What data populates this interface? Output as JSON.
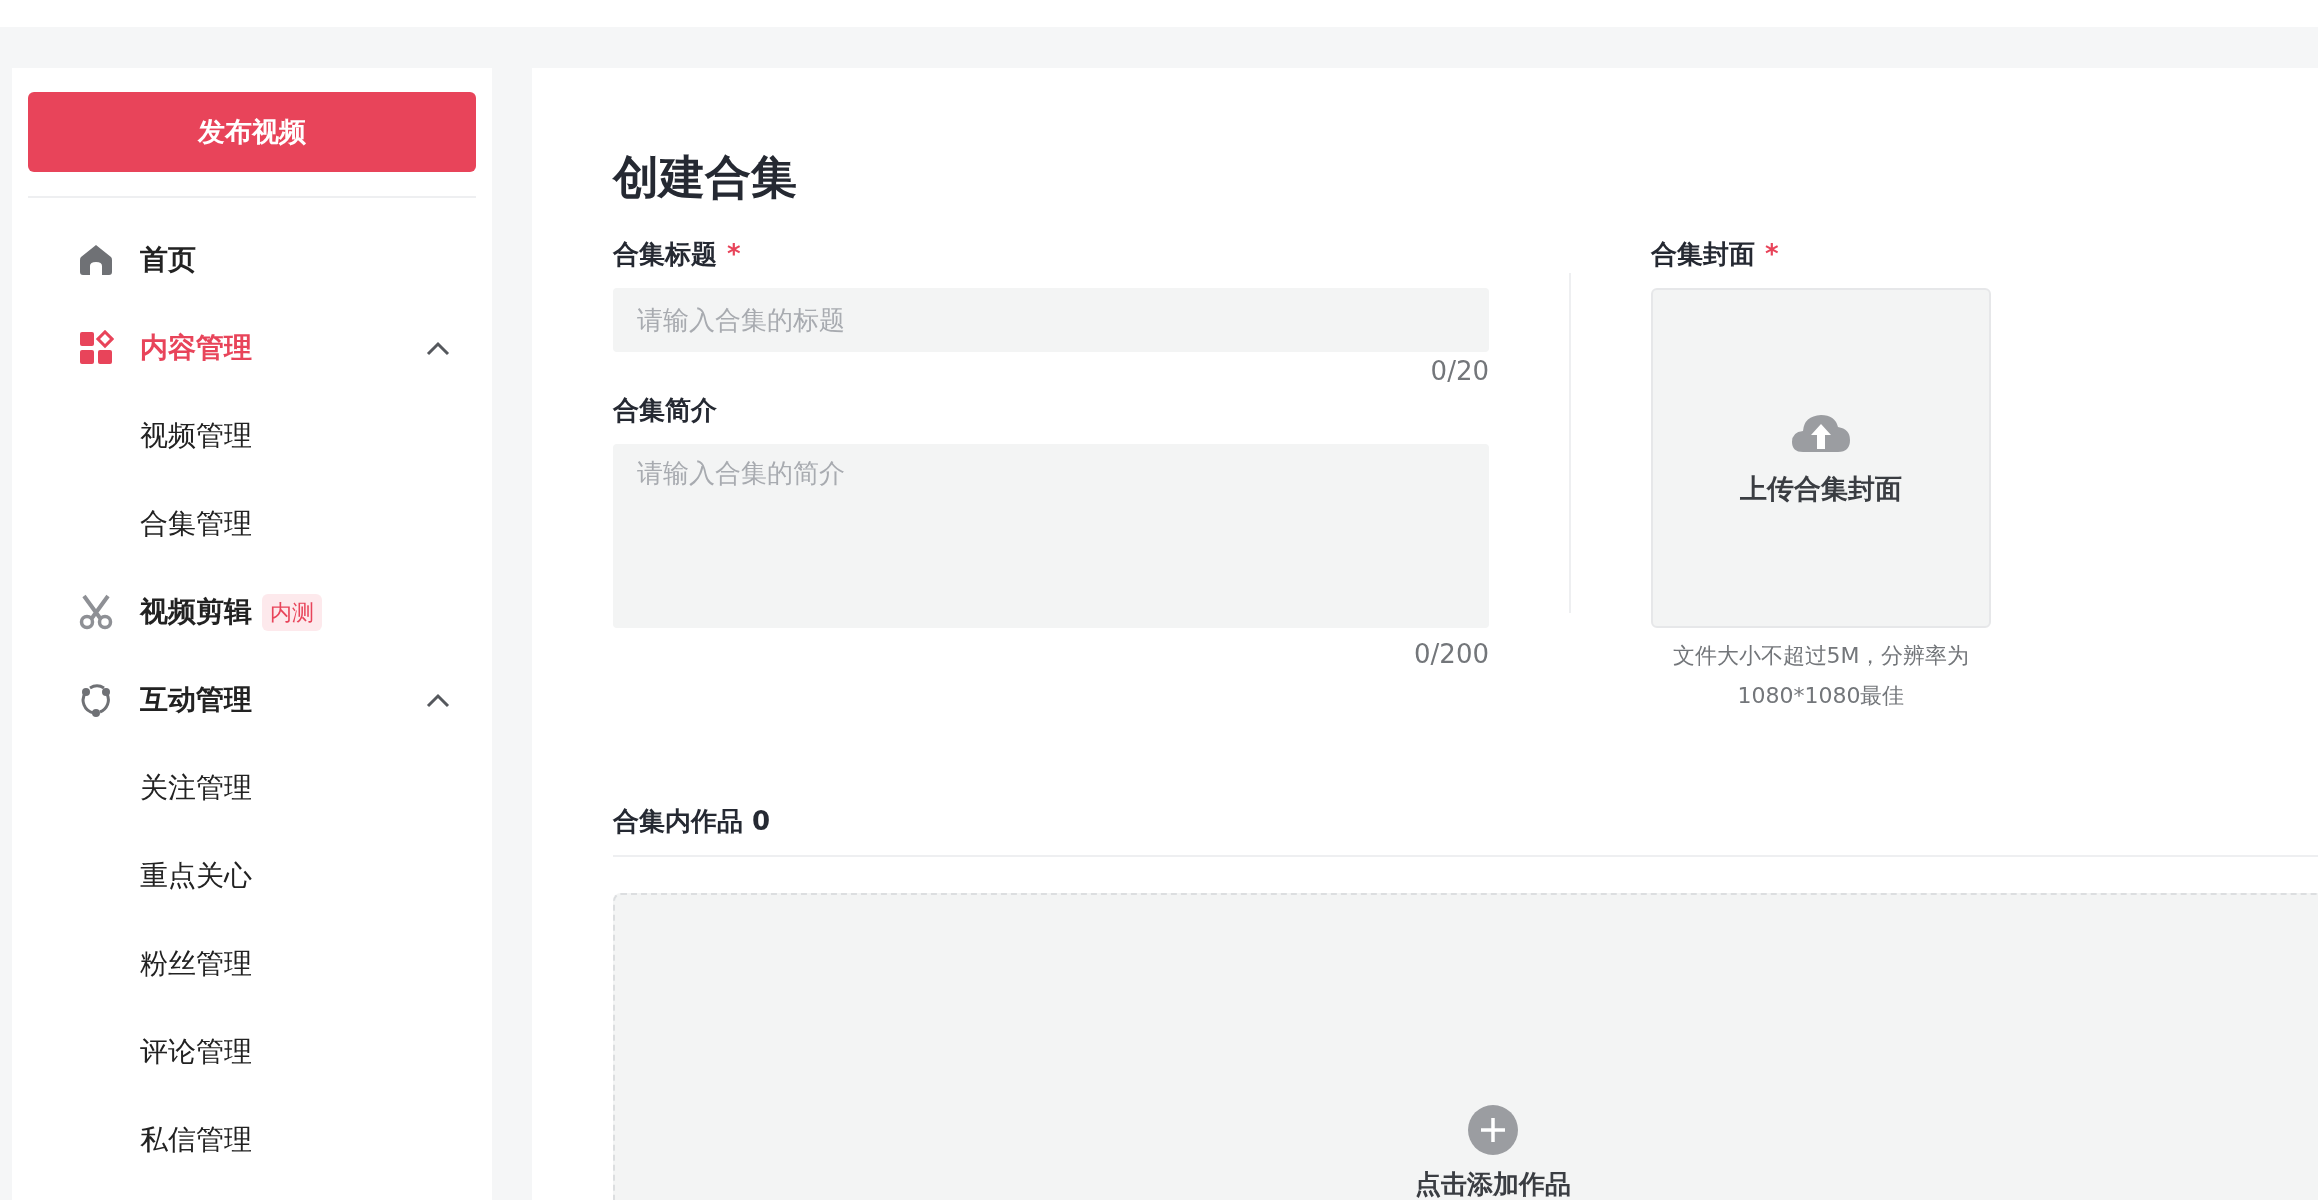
{
  "sidebar": {
    "publish_button": "发布视频",
    "menu": [
      {
        "label": "首页",
        "selected": false
      },
      {
        "label": "内容管理",
        "selected": true,
        "expanded": true,
        "children": [
          {
            "label": "视频管理",
            "selected": false
          },
          {
            "label": "合集管理",
            "selected": false
          }
        ]
      },
      {
        "label": "视频剪辑",
        "selected": false,
        "badge": "内测"
      },
      {
        "label": "互动管理",
        "selected": false,
        "expanded": true,
        "children": [
          {
            "label": "关注管理",
            "selected": false
          },
          {
            "label": "重点关心",
            "selected": false
          },
          {
            "label": "粉丝管理",
            "selected": false
          },
          {
            "label": "评论管理",
            "selected": false
          },
          {
            "label": "私信管理",
            "selected": false
          }
        ]
      }
    ]
  },
  "form": {
    "title": "创建合集",
    "fields": [
      {
        "label": "合集标题",
        "required_mark": "*",
        "kind": "input",
        "placeholder": "请输入合集的标题",
        "counter": "0/20"
      },
      {
        "label": "合集简介",
        "kind": "textarea",
        "placeholder": "请输入合集的简介",
        "counter": "0/200"
      }
    ],
    "cover": {
      "label": "合集封面",
      "required_mark": "*",
      "upload_text": "上传合集封面",
      "hint": "文件大小不超过5M，分辨率为1080*1080最佳"
    },
    "works": {
      "heading": "合集内作品 0",
      "add_text": "点击添加作品"
    }
  }
}
